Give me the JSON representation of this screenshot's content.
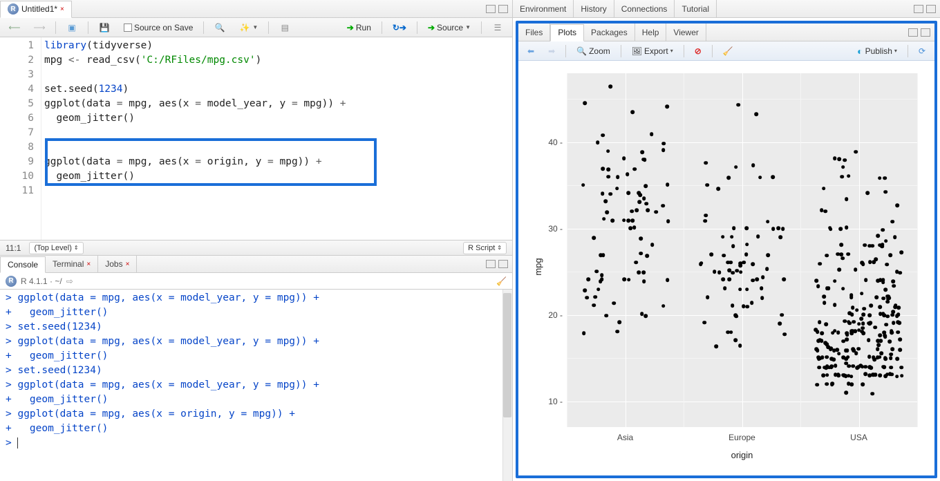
{
  "left": {
    "editor_tab": {
      "name": "Untitled1*",
      "dirty": true
    },
    "toolbar": {
      "source_on_save": "Source on Save",
      "run": "Run",
      "source": "Source"
    },
    "code_lines": [
      {
        "n": 1,
        "html": "<span class='kw'>library</span>(tidyverse)"
      },
      {
        "n": 2,
        "html": "mpg <span class='op'>&lt;-</span> read_csv(<span class='str'>'C:/RFiles/mpg.csv'</span>)"
      },
      {
        "n": 3,
        "html": ""
      },
      {
        "n": 4,
        "html": "set.seed(<span class='num'>1234</span>)"
      },
      {
        "n": 5,
        "html": "ggplot(data <span class='op'>=</span> mpg, aes(x <span class='op'>=</span> model_year, y <span class='op'>=</span> mpg)) <span class='op'>+</span>"
      },
      {
        "n": 6,
        "html": "  geom_jitter()"
      },
      {
        "n": 7,
        "html": ""
      },
      {
        "n": 8,
        "html": "",
        "boxed_start": true
      },
      {
        "n": 9,
        "html": "ggplot(data <span class='op'>=</span> mpg, aes(x <span class='op'>=</span> origin, y <span class='op'>=</span> mpg)) <span class='op'>+</span>"
      },
      {
        "n": 10,
        "html": "  geom_jitter()",
        "boxed_end": true
      },
      {
        "n": 11,
        "html": ""
      }
    ],
    "status": {
      "pos": "11:1",
      "scope": "(Top Level)",
      "ftype": "R Script"
    },
    "console_tabs": [
      "Console",
      "Terminal",
      "Jobs"
    ],
    "console_path": "R 4.1.1 · ~/",
    "console_lines": [
      "> ggplot(data = mpg, aes(x = model_year, y = mpg)) +",
      "+   geom_jitter()",
      "> set.seed(1234)",
      "> ggplot(data = mpg, aes(x = model_year, y = mpg)) +",
      "+   geom_jitter()",
      "> set.seed(1234)",
      "> ggplot(data = mpg, aes(x = model_year, y = mpg)) +",
      "+   geom_jitter()",
      "> ggplot(data = mpg, aes(x = origin, y = mpg)) +",
      "+   geom_jitter()",
      "> |"
    ]
  },
  "right": {
    "top_tabs": [
      "Environment",
      "History",
      "Connections",
      "Tutorial"
    ],
    "mid_tabs": [
      "Files",
      "Plots",
      "Packages",
      "Help",
      "Viewer"
    ],
    "mid_active": "Plots",
    "plots_tb": {
      "zoom": "Zoom",
      "export": "Export",
      "publish": "Publish"
    }
  },
  "chart_data": {
    "type": "scatter",
    "xlabel": "origin",
    "ylabel": "mpg",
    "x_categories": [
      "Asia",
      "Europe",
      "USA"
    ],
    "y_ticks": [
      10,
      20,
      30,
      40
    ],
    "ylim": [
      7,
      48
    ],
    "series": [
      {
        "name": "Asia",
        "x_index": 0,
        "jitter_w": 0.37,
        "n": 79,
        "values": [
          18,
          24,
          24,
          27,
          25,
          31,
          35,
          24,
          19,
          27,
          20,
          22,
          18,
          21,
          30,
          31,
          32,
          33,
          39,
          24,
          31,
          24,
          26,
          29,
          22,
          20,
          23,
          32,
          21.5,
          32.8,
          46.6,
          24.5,
          33.5,
          20,
          23,
          25,
          29,
          31,
          31,
          32,
          33,
          34,
          34,
          35,
          36,
          37,
          38,
          38,
          39,
          40,
          24,
          25,
          27,
          28,
          31,
          32,
          32,
          33,
          34,
          34,
          35,
          36,
          37,
          37,
          38,
          39,
          40,
          41,
          44.6,
          40.8,
          44,
          43.4,
          36.4,
          30,
          27.2,
          21.1,
          23.9,
          34.2,
          34.7
        ]
      },
      {
        "name": "Europe",
        "x_index": 1,
        "jitter_w": 0.37,
        "n": 70,
        "values": [
          26,
          25,
          25,
          24,
          26,
          27,
          30,
          22,
          28,
          24,
          19,
          23,
          20,
          25,
          21,
          24,
          20,
          26,
          29,
          21,
          26,
          27,
          18,
          30,
          36,
          22,
          21.5,
          43.1,
          29.8,
          16.5,
          31.5,
          17,
          18,
          19,
          20,
          21,
          23,
          23,
          24,
          24,
          25,
          25,
          25,
          26,
          26,
          26,
          27,
          27,
          28,
          29,
          29,
          30,
          30,
          31,
          35.1,
          36,
          36,
          37,
          37.7,
          37.3,
          16.2,
          17.6,
          23,
          24.2,
          25.4,
          25.8,
          29,
          30.7,
          34.5,
          44.3
        ]
      },
      {
        "name": "USA",
        "x_index": 2,
        "jitter_w": 0.37,
        "n": 249,
        "values": [
          18,
          15,
          16,
          17,
          15,
          14,
          14,
          14,
          15,
          15,
          14,
          24,
          22,
          18,
          21,
          27,
          26,
          25,
          16,
          17,
          19,
          18,
          14,
          14,
          14,
          14,
          12,
          13,
          13,
          18,
          22,
          19,
          18,
          23,
          28,
          15,
          16,
          16,
          18,
          22,
          14,
          13,
          14,
          15,
          16,
          12,
          13,
          13,
          14,
          15,
          15,
          17,
          11,
          13,
          12,
          13,
          15,
          18,
          19,
          21,
          13,
          14,
          15,
          16,
          17,
          18,
          19,
          20,
          12,
          13,
          15,
          16,
          18,
          19,
          17.5,
          14.5,
          15.5,
          26,
          22,
          28,
          24,
          20,
          13,
          14,
          15,
          14,
          23,
          20,
          21,
          13,
          15,
          13,
          13,
          14,
          18,
          19,
          19,
          19,
          20.5,
          15.5,
          17.5,
          16,
          15.5,
          20,
          19,
          18,
          16,
          17,
          22,
          24,
          25,
          26,
          27,
          28,
          29,
          30,
          36,
          37,
          38,
          13,
          14,
          19,
          19,
          14,
          15,
          15,
          16,
          16,
          13,
          13,
          14,
          14,
          14,
          18,
          16,
          17,
          18,
          20,
          14,
          15,
          16,
          17,
          20,
          12,
          13,
          13,
          15,
          11,
          12,
          13,
          13,
          18,
          21,
          22,
          24,
          26,
          19.1,
          18.1,
          17.5,
          18.6,
          19.4,
          20.2,
          20.5,
          18.2,
          17.6,
          16.2,
          16.5,
          17,
          23.2,
          24.2,
          25.4,
          25.1,
          26.6,
          27.2,
          27.9,
          28.1,
          28.4,
          30,
          30.9,
          32.1,
          33.5,
          34.2,
          34.7,
          36,
          36.1,
          38.1,
          39,
          32.7,
          23.8,
          29.9,
          21.6,
          16.9,
          15.5,
          19.2,
          18.5,
          20.6,
          20.8,
          22.4,
          23.5,
          23.9,
          25.8,
          26.8,
          27,
          22,
          28,
          23,
          21,
          20,
          21,
          19,
          18,
          14,
          15,
          16,
          17,
          18,
          19,
          20,
          15,
          14,
          13,
          12,
          19.2,
          38,
          36,
          34,
          32,
          30,
          28,
          26,
          24,
          22,
          17,
          21.5,
          18.2,
          16.5,
          19.9,
          20.2,
          13,
          29,
          30,
          22.4,
          26.6,
          23,
          27
        ]
      }
    ]
  }
}
